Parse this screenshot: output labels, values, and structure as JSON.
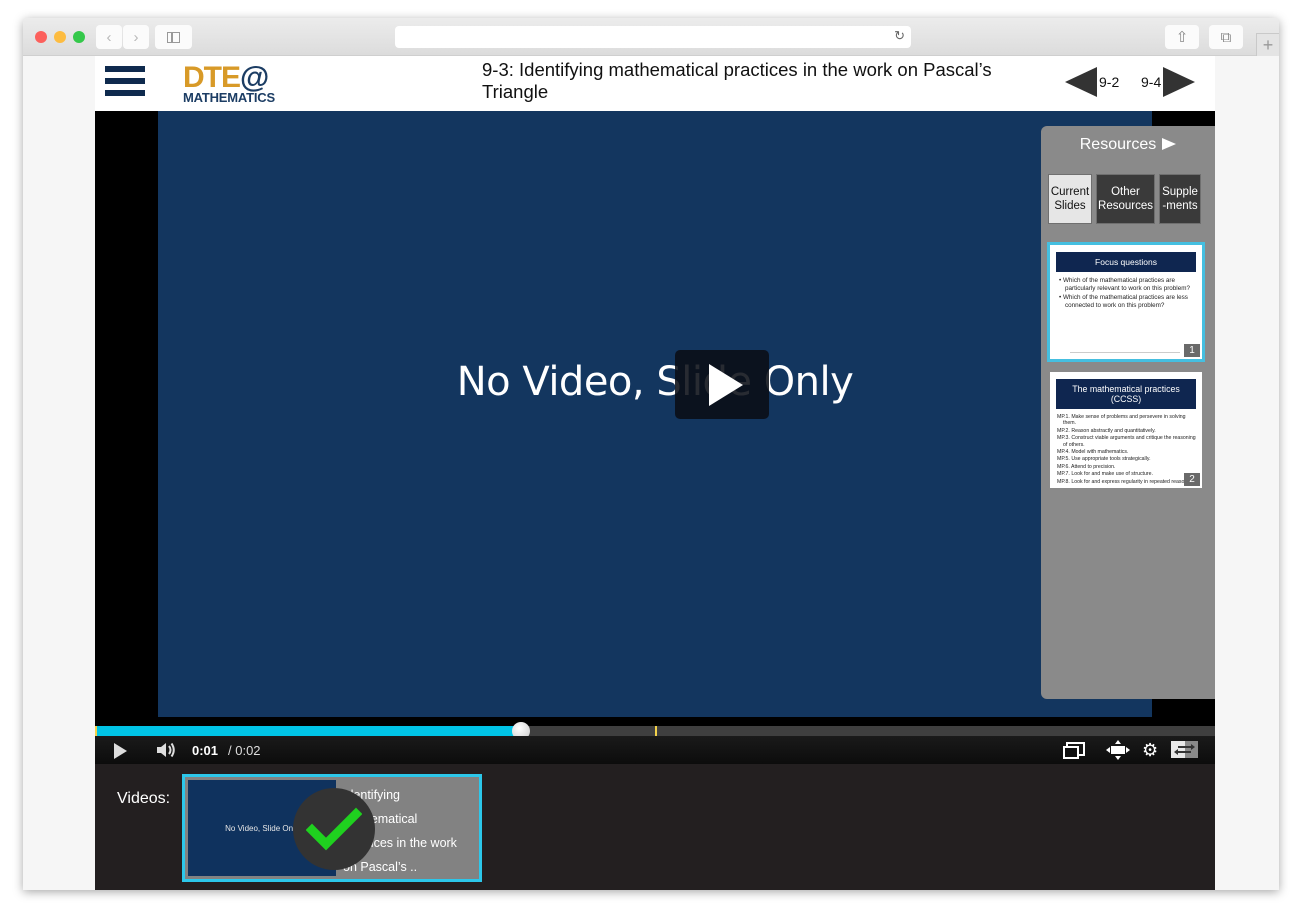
{
  "browser": {
    "back_icon": "‹",
    "forward_icon": "›",
    "reload_icon": "↻",
    "share_icon": "⇧",
    "tabs_icon": "⧉",
    "newtab_icon": "+"
  },
  "header": {
    "logo_top_dte": "DTE",
    "logo_top_at": "@",
    "logo_bottom": "MATHEMATICS",
    "title": "9-3: Identifying mathematical practices in the work on Pascal’s Triangle",
    "prev_label": "9-2",
    "next_label": "9-4"
  },
  "player": {
    "slide_text": "No Video, Slide Only",
    "current_time": "0:01",
    "duration": "/ 0:02",
    "progress_fraction": 0.38,
    "marker_fraction": 0.5
  },
  "resources": {
    "title": "Resources",
    "tabs": [
      {
        "label": "Current Slides",
        "active": true
      },
      {
        "label": "Other Resources",
        "active": false
      },
      {
        "label": "Supple -ments",
        "active": false
      }
    ],
    "slides": [
      {
        "heading": "Focus questions",
        "number": "1",
        "bullets": [
          "Which of the mathematical practices are particularly relevant to work on this problem?",
          "Which of the mathematical practices are less connected to work on this problem?"
        ]
      },
      {
        "heading": "The mathematical practices (CCSS)",
        "number": "2",
        "bullets": [
          "MP.1. Make sense of problems and persevere in solving them.",
          "MP.2. Reason abstractly and quantitatively.",
          "MP.3. Construct viable arguments and critique the reasoning of others.",
          "MP.4. Model with mathematics.",
          "MP.5. Use appropriate tools strategically.",
          "MP.6. Attend to precision.",
          "MP.7. Look for and make use of structure.",
          "MP.8. Look for and express regularity in repeated reasoning."
        ]
      }
    ]
  },
  "videos": {
    "label": "Videos:",
    "items": [
      {
        "thumb_text": "No Video, Slide Only",
        "title_lines": [
          "Identifying",
          "mathematical",
          "practices in the work",
          "on Pascal’s .."
        ],
        "watched": true
      }
    ]
  },
  "colors": {
    "accent_cyan": "#00c4e6",
    "logo_gold": "#d89a28",
    "logo_navy": "#1c3d64",
    "slide_blue": "#13365f",
    "check_green": "#1fd11f"
  }
}
